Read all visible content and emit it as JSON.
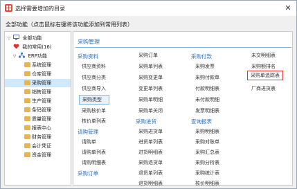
{
  "window": {
    "title": "选择需要增加的目录",
    "close": "✕"
  },
  "hint": "全部功能（点击鼠标右键将该功能添加到常用列表）",
  "tree": {
    "root": "全部功能",
    "favorites": "我的常用(16)",
    "erp": "ERP功能",
    "modules": [
      "系统管理",
      "仓库管理",
      "采购管理",
      "销售管理",
      "生产管理",
      "条码管理",
      "质量管理",
      "报表中心",
      "财务管理",
      "会计凭证",
      "资金管理"
    ],
    "selected_module": "采购管理"
  },
  "panel": {
    "title": "采购管理",
    "col1": {
      "h1": "采购资料",
      "items1": [
        "供应商资料",
        "供应商分类",
        "供应商导入",
        "采购类型",
        "采购核价单",
        "核价单列表"
      ],
      "h2": "请购管理",
      "items2": [
        "请购单",
        "请购单列表",
        "请购明细表"
      ],
      "h3": "采购订单"
    },
    "col2": {
      "items1": [
        "采购订单",
        "采购单列表",
        "采购变更单",
        "变更单列表",
        "采购单明细",
        "采购单关闭"
      ],
      "h1": "采购进货",
      "items2": [
        "采购进货单",
        "进货单列表",
        "进货明细表",
        "采购退货单",
        "退货单列表",
        "退货明细表",
        "验退单列表",
        "采购验退单"
      ]
    },
    "col3": {
      "h1": "采购付款",
      "items1": [
        "采购发票",
        "采购付款单",
        "付款明细表",
        "未付款明细",
        "发票明细表"
      ],
      "h2": "查询报表",
      "items2": [
        "采购明细表",
        "采购对账单",
        "采购汇总表",
        "采购分析表",
        "采购统计表",
        "核价明细表"
      ]
    },
    "col4": {
      "items": [
        "未交明细表",
        "采购额排名",
        "采购单追踪表",
        "厂商进货表"
      ],
      "highlighted": "采购单追踪表"
    },
    "selected_item": "采购类型"
  }
}
